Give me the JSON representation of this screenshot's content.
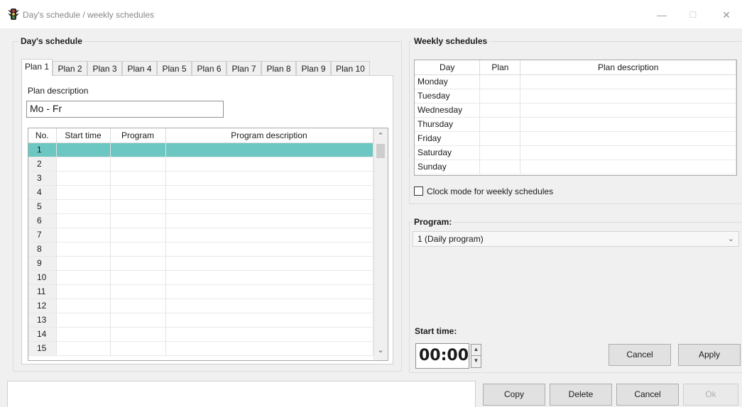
{
  "window": {
    "title": "Day's schedule / weekly schedules",
    "minimize_glyph": "—",
    "maximize_glyph": "☐",
    "close_glyph": "✕"
  },
  "day_schedule": {
    "group_title": "Day's schedule",
    "tabs": [
      "Plan 1",
      "Plan 2",
      "Plan 3",
      "Plan 4",
      "Plan 5",
      "Plan 6",
      "Plan 7",
      "Plan 8",
      "Plan 9",
      "Plan 10"
    ],
    "active_tab": 0,
    "plan_description_label": "Plan description",
    "plan_description_value": "Mo - Fr",
    "columns": [
      "No.",
      "Start time",
      "Program",
      "Program description"
    ],
    "rows": [
      "1",
      "2",
      "3",
      "4",
      "5",
      "6",
      "7",
      "8",
      "9",
      "10",
      "11",
      "12",
      "13",
      "14",
      "15"
    ],
    "selected_row": 0
  },
  "weekly_schedules": {
    "group_title": "Weekly schedules",
    "columns": [
      "Day",
      "Plan",
      "Plan description"
    ],
    "days": [
      "Monday",
      "Tuesday",
      "Wednesday",
      "Thursday",
      "Friday",
      "Saturday",
      "Sunday"
    ],
    "clock_mode_label": "Clock mode for weekly schedules",
    "clock_mode_checked": false
  },
  "program": {
    "label": "Program:",
    "selected": "1 (Daily program)"
  },
  "start_time": {
    "label": "Start time:",
    "value": "00:00"
  },
  "buttons": {
    "cancel_right": "Cancel",
    "apply": "Apply",
    "copy": "Copy",
    "delete": "Delete",
    "cancel_bottom": "Cancel",
    "ok": "Ok"
  },
  "colors": {
    "selection": "#6cc6c1",
    "window_bg": "#f0f0f0"
  },
  "icons": {
    "app": "traffic-light-icon",
    "scroll_up": "chevron-up-icon",
    "scroll_down": "chevron-down-icon",
    "combo": "chevron-down-icon"
  }
}
